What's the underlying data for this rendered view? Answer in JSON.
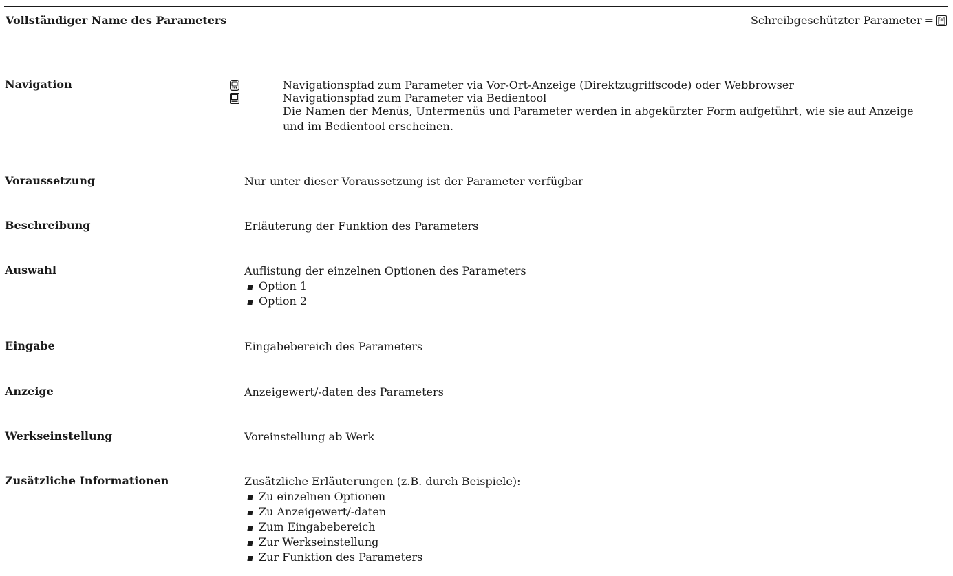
{
  "header": {
    "title": "Vollständiger Name des Parameters",
    "readonly_label": "Schreibgeschützter Parameter",
    "equals": "=",
    "readonly_icon": "lock-icon"
  },
  "rows": {
    "navigation": {
      "label": "Navigation",
      "line1_icon": "local-display-icon",
      "line1": "Navigationspfad zum Parameter via Vor-Ort-Anzeige (Direktzugriffscode) oder Webbrowser",
      "line2_icon": "operating-tool-icon",
      "line2": "Navigationspfad zum Parameter via Bedientool",
      "note": "Die Namen der Menüs, Untermenüs und Parameter werden in abgekürzter Form aufgeführt, wie sie auf Anzeige und im Bedientool erscheinen."
    },
    "voraussetzung": {
      "label": "Voraussetzung",
      "value": "Nur unter dieser Voraussetzung ist der Parameter verfügbar"
    },
    "beschreibung": {
      "label": "Beschreibung",
      "value": "Erläuterung der Funktion des Parameters"
    },
    "auswahl": {
      "label": "Auswahl",
      "value": "Auflistung der einzelnen Optionen des Parameters",
      "items": [
        "Option 1",
        "Option 2"
      ]
    },
    "eingabe": {
      "label": "Eingabe",
      "value": "Eingabebereich des Parameters"
    },
    "anzeige": {
      "label": "Anzeige",
      "value": "Anzeigewert/-daten des Parameters"
    },
    "werkseinstellung": {
      "label": "Werkseinstellung",
      "value": "Voreinstellung ab Werk"
    },
    "zusaetzlich": {
      "label": "Zusätzliche Informationen",
      "value": "Zusätzliche Erläuterungen (z.B. durch Beispiele):",
      "items": [
        "Zu einzelnen Optionen",
        "Zu Anzeigewert/-daten",
        "Zum Eingabebereich",
        "Zur Werkseinstellung",
        "Zur Funktion des Parameters"
      ]
    }
  }
}
